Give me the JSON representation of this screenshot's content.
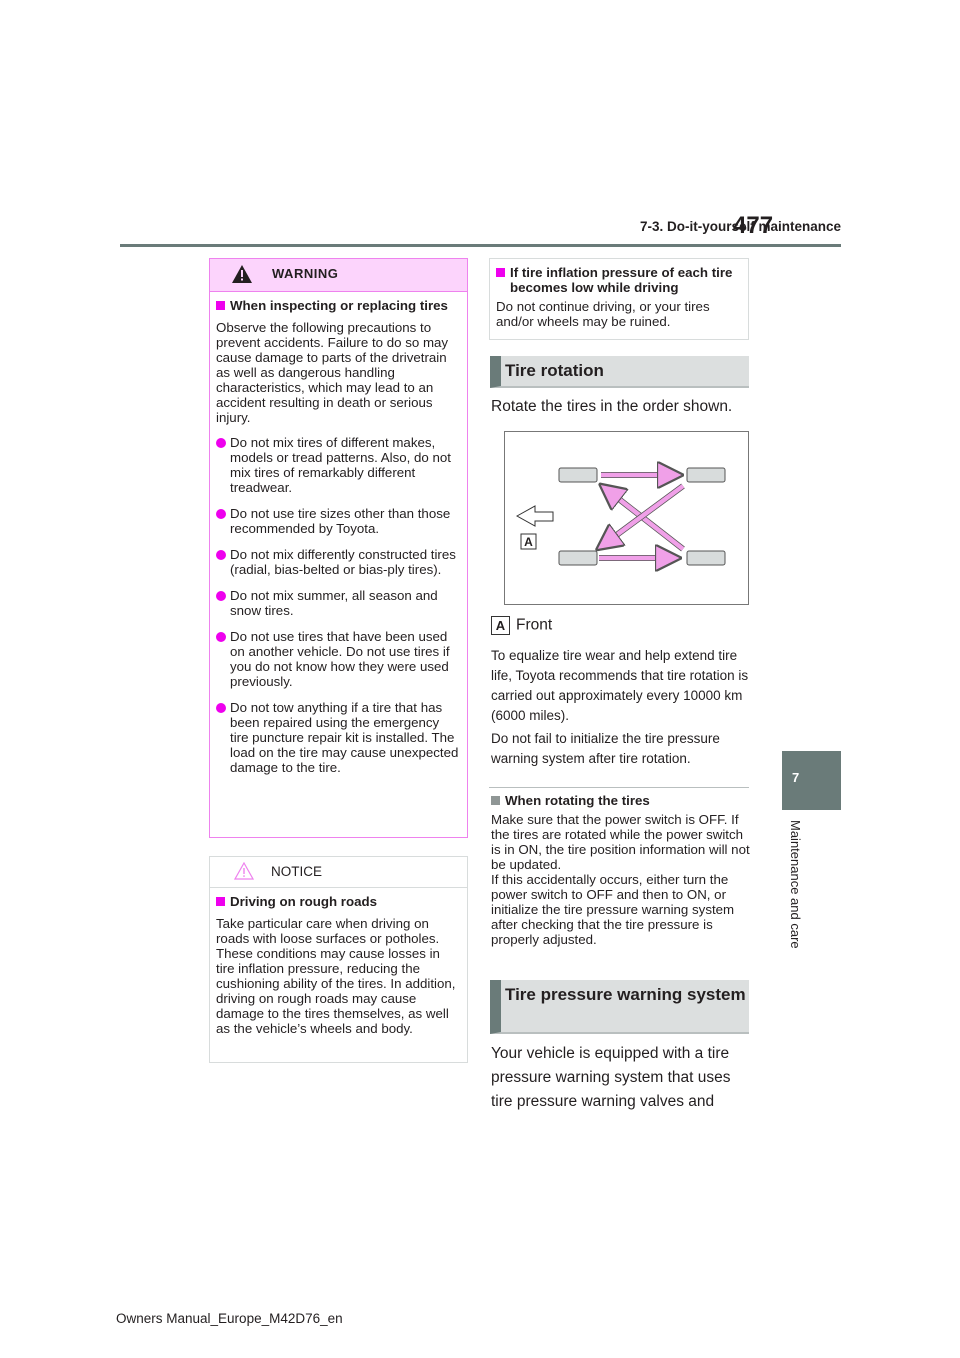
{
  "header": {
    "section": "7-3. Do-it-yourself maintenance",
    "page_number": "477"
  },
  "side_tab": {
    "chapter_number": "7",
    "chapter_title": "Maintenance and care"
  },
  "footer": "Owners Manual_Europe_M42D76_en",
  "warning": {
    "title": "WARNING",
    "subheading": "When inspecting or replacing tires",
    "intro": "Observe the following precautions to prevent accidents. Failure to do so may cause damage to parts of the drivetrain as well as dangerous handling characteristics, which may lead to an accident resulting in death or serious injury.",
    "bullets": [
      "Do not mix tires of different makes, models or tread patterns. Also, do not mix tires of remarkably different treadwear.",
      "Do not use tire sizes other than those recommended by Toyota.",
      "Do not mix differently constructed tires (radial, bias-belted or bias-ply tires).",
      "Do not mix summer, all season and snow tires.",
      "Do not use tires that have been used on another vehicle. Do not use tires if you do not know how they were used previously.",
      "Do not tow anything if a tire that has been repaired using the emergency tire puncture repair kit is installed. The load on the tire may cause unexpected damage to the tire."
    ]
  },
  "notice": {
    "title": "NOTICE",
    "subheading": "Driving on rough roads",
    "text": "Take particular care when driving on roads with loose surfaces or potholes. These conditions may cause losses in tire inflation pressure, reducing the cushioning ability of the tires. In addition, driving on rough roads may cause damage to the tires themselves, as well as the vehicle’s wheels and body."
  },
  "info_box": {
    "subheading": "If tire inflation pressure of each tire becomes low while driving",
    "text": "Do not continue driving, or your tires and/or wheels may be ruined."
  },
  "tire_rotation": {
    "heading": "Tire rotation",
    "intro": "Rotate the tires in the order shown.",
    "diagram_label": "A",
    "legend_key": "A",
    "legend_text": "Front",
    "para1": "To equalize tire wear and help extend tire life, Toyota recommends that tire rotation is carried out approximately every 10000 km (6000 miles).",
    "para2": "Do not fail to initialize the tire pressure warning system after tire rotation."
  },
  "rotating_note": {
    "subheading": "When rotating the tires",
    "text1": "Make sure that the power switch is OFF. If the tires are rotated while the power switch is in ON, the tire position information will not be updated.",
    "text2": "If this accidentally occurs, either turn the power switch to OFF and then to ON, or initialize the tire pressure warning system after checking that the tire pressure is properly adjusted."
  },
  "tpws": {
    "heading": "Tire pressure warning system",
    "text": "Your vehicle is equipped with a tire pressure warning system that uses tire pressure warning valves and"
  },
  "colors": {
    "accent_magenta": "#ee00ee",
    "warning_bg": "#fcd4fc",
    "section_gray": "#6a7b79",
    "arrow_pink": "#f0a0e8"
  }
}
